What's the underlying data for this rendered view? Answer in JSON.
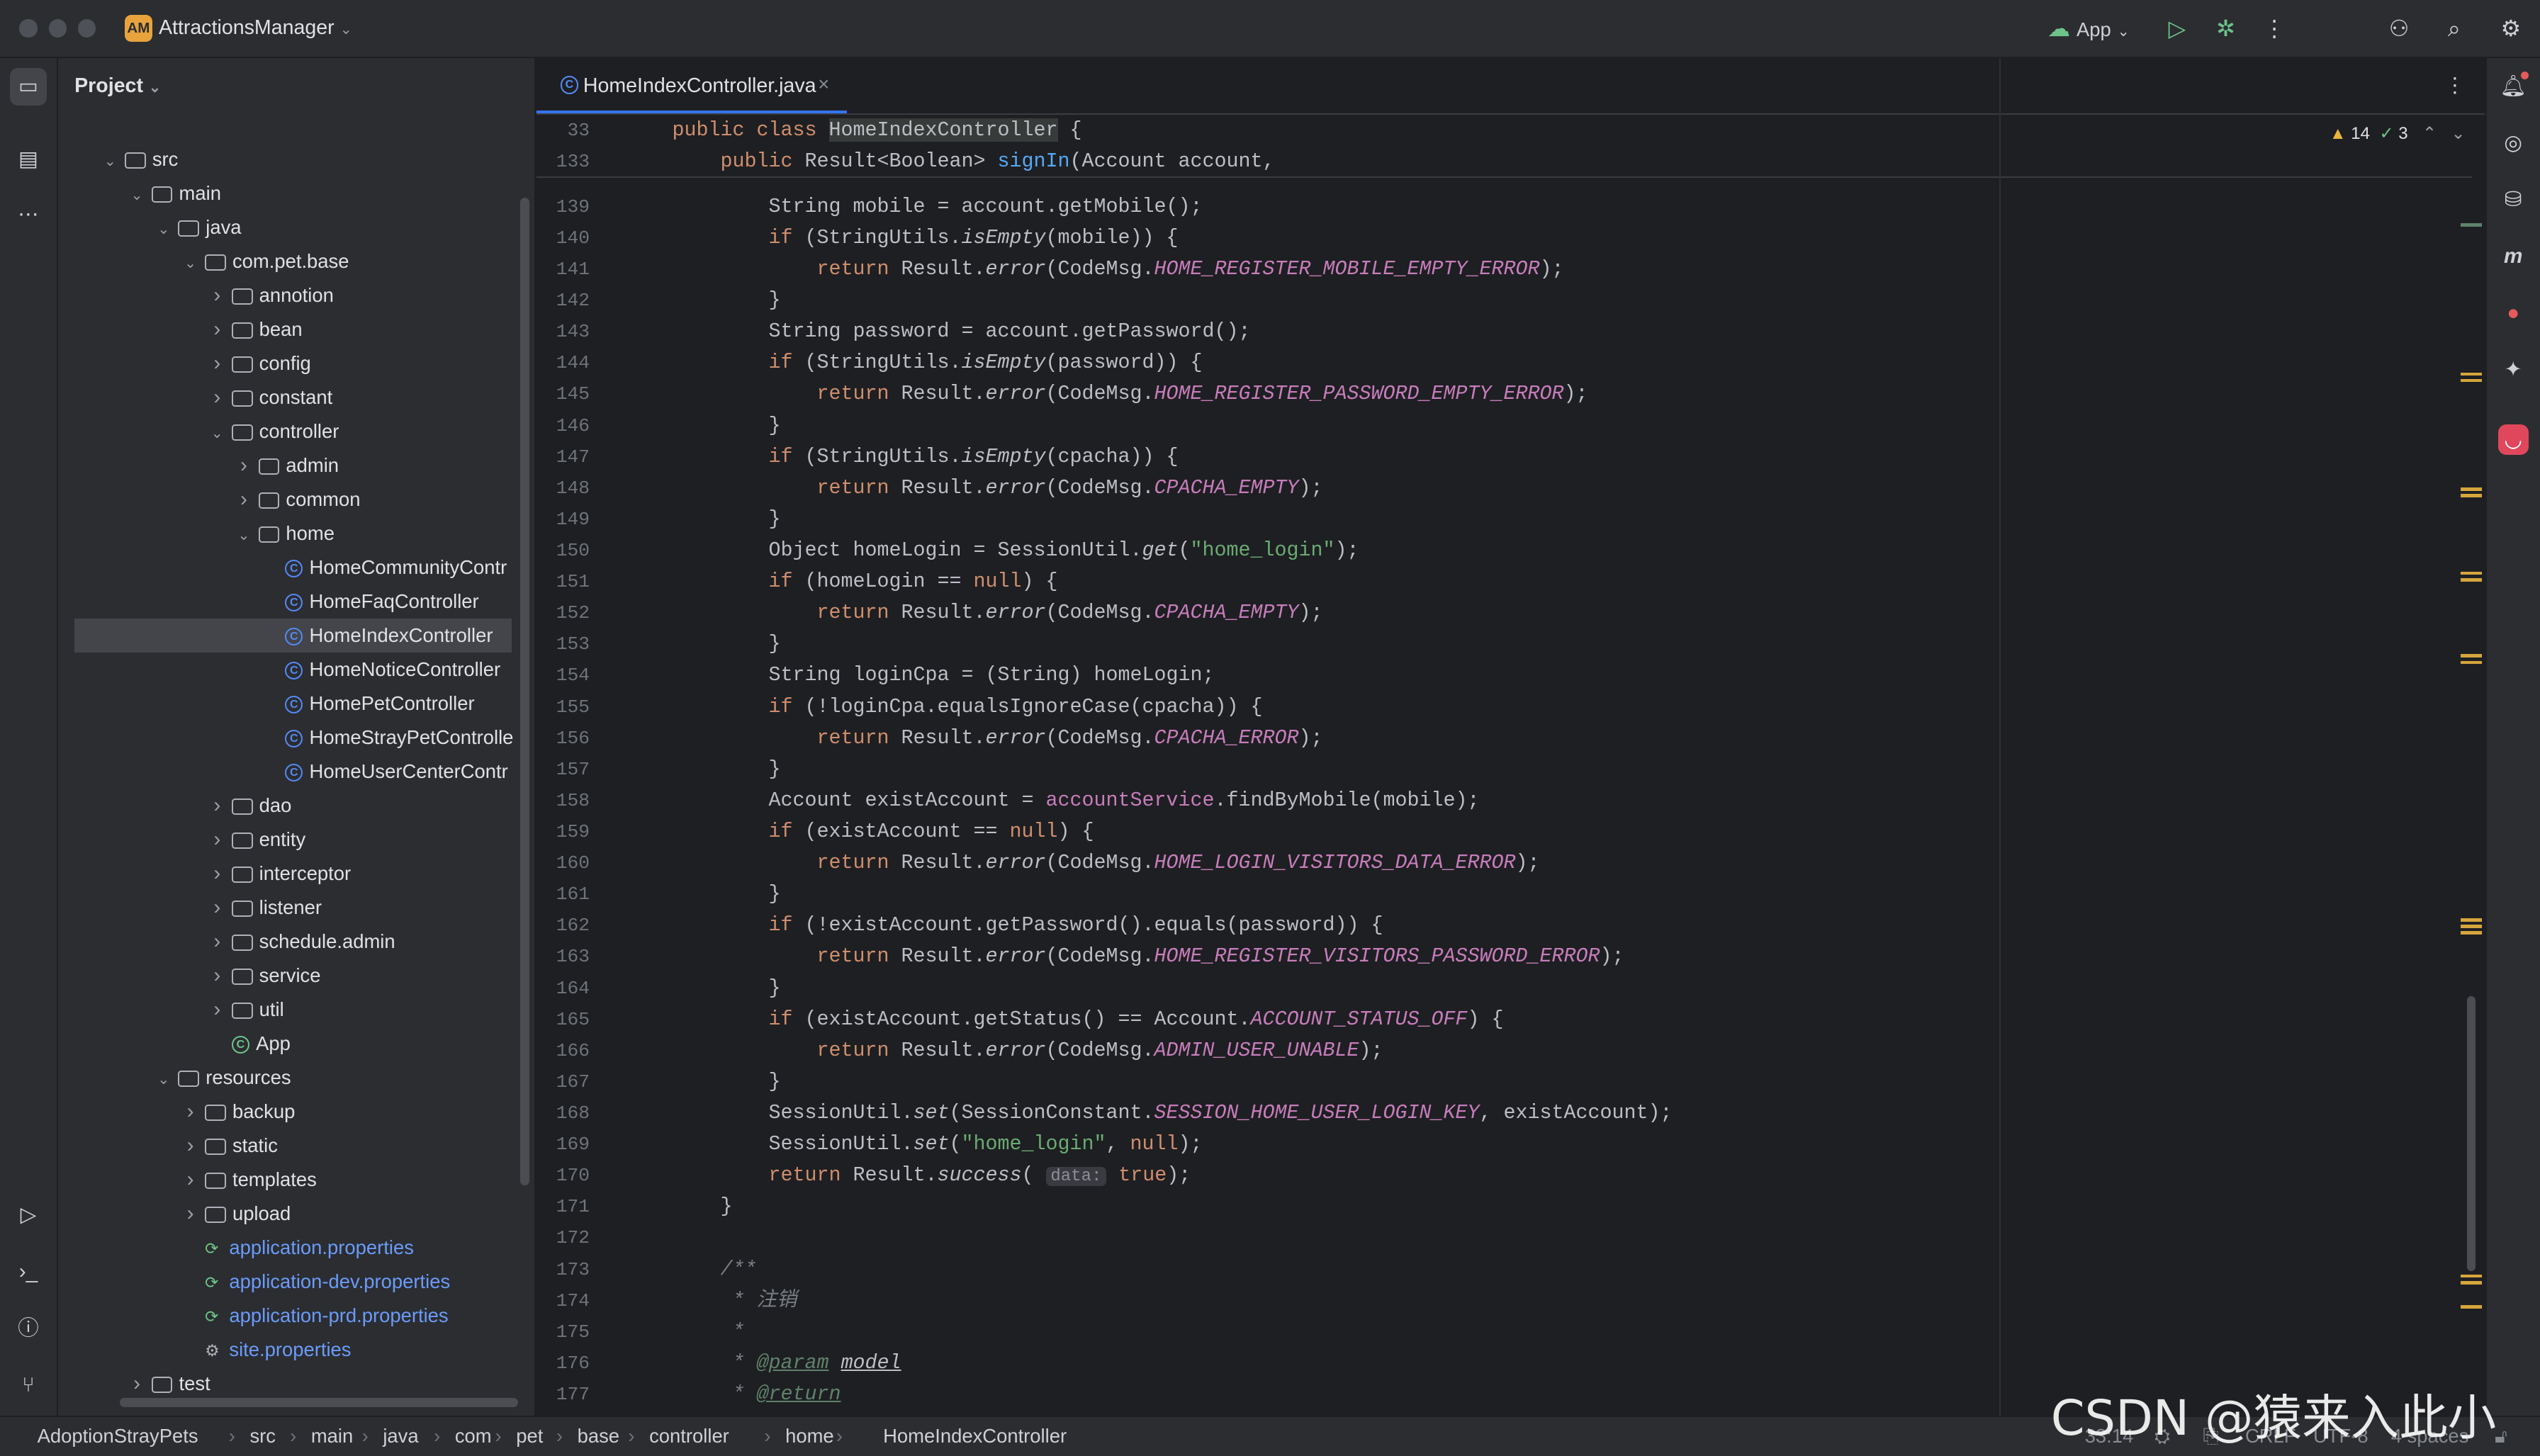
{
  "window": {
    "project_badge": "AM",
    "project_name": "AttractionsManager",
    "run_config": "App"
  },
  "project_panel": {
    "title": "Project",
    "tree": [
      {
        "label": "src",
        "depth": 1,
        "open": true,
        "kind": "folder"
      },
      {
        "label": "main",
        "depth": 2,
        "open": true,
        "kind": "folder"
      },
      {
        "label": "java",
        "depth": 3,
        "open": true,
        "kind": "folder"
      },
      {
        "label": "com.pet.base",
        "depth": 4,
        "open": true,
        "kind": "pkg"
      },
      {
        "label": "annotion",
        "depth": 5,
        "open": false,
        "kind": "pkg"
      },
      {
        "label": "bean",
        "depth": 5,
        "open": false,
        "kind": "pkg"
      },
      {
        "label": "config",
        "depth": 5,
        "open": false,
        "kind": "pkg"
      },
      {
        "label": "constant",
        "depth": 5,
        "open": false,
        "kind": "pkg"
      },
      {
        "label": "controller",
        "depth": 5,
        "open": true,
        "kind": "pkg"
      },
      {
        "label": "admin",
        "depth": 6,
        "open": false,
        "kind": "pkg"
      },
      {
        "label": "common",
        "depth": 6,
        "open": false,
        "kind": "pkg"
      },
      {
        "label": "home",
        "depth": 6,
        "open": true,
        "kind": "pkg"
      },
      {
        "label": "HomeCommunityContr",
        "depth": 7,
        "kind": "class"
      },
      {
        "label": "HomeFaqController",
        "depth": 7,
        "kind": "class"
      },
      {
        "label": "HomeIndexController",
        "depth": 7,
        "kind": "class",
        "selected": true
      },
      {
        "label": "HomeNoticeController",
        "depth": 7,
        "kind": "class"
      },
      {
        "label": "HomePetController",
        "depth": 7,
        "kind": "class"
      },
      {
        "label": "HomeStrayPetControlle",
        "depth": 7,
        "kind": "class"
      },
      {
        "label": "HomeUserCenterContr",
        "depth": 7,
        "kind": "class"
      },
      {
        "label": "dao",
        "depth": 5,
        "open": false,
        "kind": "pkg"
      },
      {
        "label": "entity",
        "depth": 5,
        "open": false,
        "kind": "pkg"
      },
      {
        "label": "interceptor",
        "depth": 5,
        "open": false,
        "kind": "pkg"
      },
      {
        "label": "listener",
        "depth": 5,
        "open": false,
        "kind": "pkg"
      },
      {
        "label": "schedule.admin",
        "depth": 5,
        "open": false,
        "kind": "pkg"
      },
      {
        "label": "service",
        "depth": 5,
        "open": false,
        "kind": "pkg"
      },
      {
        "label": "util",
        "depth": 5,
        "open": false,
        "kind": "pkg"
      },
      {
        "label": "App",
        "depth": 5,
        "kind": "app"
      },
      {
        "label": "resources",
        "depth": 3,
        "open": true,
        "kind": "folder"
      },
      {
        "label": "backup",
        "depth": 4,
        "open": false,
        "kind": "folder"
      },
      {
        "label": "static",
        "depth": 4,
        "open": false,
        "kind": "folder"
      },
      {
        "label": "templates",
        "depth": 4,
        "open": false,
        "kind": "folder"
      },
      {
        "label": "upload",
        "depth": 4,
        "open": false,
        "kind": "folder"
      },
      {
        "label": "application.properties",
        "depth": 4,
        "kind": "prop"
      },
      {
        "label": "application-dev.properties",
        "depth": 4,
        "kind": "prop"
      },
      {
        "label": "application-prd.properties",
        "depth": 4,
        "kind": "prop"
      },
      {
        "label": "site.properties",
        "depth": 4,
        "kind": "settings"
      },
      {
        "label": "test",
        "depth": 2,
        "open": false,
        "kind": "folder"
      }
    ]
  },
  "editor": {
    "tab_label": "HomeIndexController.java",
    "inspections": {
      "warnings": "14",
      "ok": "3"
    },
    "sticky": [
      {
        "n": "33",
        "html": "<span class=\"kw\">public class</span> <span class=\"hl\">HomeIndexController</span> {"
      },
      {
        "n": "133",
        "html": "    <span class=\"kw\">public</span> Result&lt;Boolean&gt; <span class=\"fn\">signIn</span>(Account account,"
      }
    ],
    "lines": [
      {
        "n": "139",
        "html": "        String mobile = account.getMobile();"
      },
      {
        "n": "140",
        "html": "        <span class=\"kw\">if</span> (StringUtils.<span class=\"it\">isEmpty</span>(mobile)) {"
      },
      {
        "n": "141",
        "html": "            <span class=\"kw\">return</span> Result.<span class=\"it\">error</span>(CodeMsg.<span class=\"cst\">HOME_REGISTER_MOBILE_EMPTY_ERROR</span>);"
      },
      {
        "n": "142",
        "html": "        }"
      },
      {
        "n": "143",
        "html": "        String password = account.getPassword();"
      },
      {
        "n": "144",
        "html": "        <span class=\"kw\">if</span> (StringUtils.<span class=\"it\">isEmpty</span>(password)) {"
      },
      {
        "n": "145",
        "html": "            <span class=\"kw\">return</span> Result.<span class=\"it\">error</span>(CodeMsg.<span class=\"cst\">HOME_REGISTER_PASSWORD_EMPTY_ERROR</span>);"
      },
      {
        "n": "146",
        "html": "        }"
      },
      {
        "n": "147",
        "html": "        <span class=\"kw\">if</span> (StringUtils.<span class=\"it\">isEmpty</span>(cpacha)) {"
      },
      {
        "n": "148",
        "html": "            <span class=\"kw\">return</span> Result.<span class=\"it\">error</span>(CodeMsg.<span class=\"cst\">CPACHA_EMPTY</span>);"
      },
      {
        "n": "149",
        "html": "        }"
      },
      {
        "n": "150",
        "html": "        Object homeLogin = SessionUtil.<span class=\"it\">get</span>(<span class=\"str\">\"home_login\"</span>);"
      },
      {
        "n": "151",
        "html": "        <span class=\"kw\">if</span> (homeLogin == <span class=\"kw\">null</span>) {"
      },
      {
        "n": "152",
        "html": "            <span class=\"kw\">return</span> Result.<span class=\"it\">error</span>(CodeMsg.<span class=\"cst\">CPACHA_EMPTY</span>);"
      },
      {
        "n": "153",
        "html": "        }"
      },
      {
        "n": "154",
        "html": "        String loginCpa = (String) homeLogin;"
      },
      {
        "n": "155",
        "html": "        <span class=\"kw\">if</span> (!loginCpa.equalsIgnoreCase(cpacha)) {"
      },
      {
        "n": "156",
        "html": "            <span class=\"kw\">return</span> Result.<span class=\"it\">error</span>(CodeMsg.<span class=\"cst\">CPACHA_ERROR</span>);"
      },
      {
        "n": "157",
        "html": "        }"
      },
      {
        "n": "158",
        "html": "        Account existAccount = <span class=\"fld\">accountService</span>.findByMobile(mobile);"
      },
      {
        "n": "159",
        "html": "        <span class=\"kw\">if</span> (existAccount == <span class=\"kw\">null</span>) {"
      },
      {
        "n": "160",
        "html": "            <span class=\"kw\">return</span> Result.<span class=\"it\">error</span>(CodeMsg.<span class=\"cst\">HOME_LOGIN_VISITORS_DATA_ERROR</span>);"
      },
      {
        "n": "161",
        "html": "        }"
      },
      {
        "n": "162",
        "html": "        <span class=\"kw\">if</span> (!existAccount.getPassword().equals(password)) {"
      },
      {
        "n": "163",
        "html": "            <span class=\"kw\">return</span> Result.<span class=\"it\">error</span>(CodeMsg.<span class=\"cst\">HOME_REGISTER_VISITORS_PASSWORD_ERROR</span>);"
      },
      {
        "n": "164",
        "html": "        }"
      },
      {
        "n": "165",
        "html": "        <span class=\"kw\">if</span> (existAccount.getStatus() == Account.<span class=\"cst\">ACCOUNT_STATUS_OFF</span>) {"
      },
      {
        "n": "166",
        "html": "            <span class=\"kw\">return</span> Result.<span class=\"it\">error</span>(CodeMsg.<span class=\"cst\">ADMIN_USER_UNABLE</span>);"
      },
      {
        "n": "167",
        "html": "        }"
      },
      {
        "n": "168",
        "html": "        SessionUtil.<span class=\"it\">set</span>(SessionConstant.<span class=\"cst\">SESSION_HOME_USER_LOGIN_KEY</span>, existAccount);"
      },
      {
        "n": "169",
        "html": "        SessionUtil.<span class=\"it\">set</span>(<span class=\"str\">\"home_login\"</span>, <span class=\"kw\">null</span>);"
      },
      {
        "n": "170",
        "html": "        <span class=\"kw\">return</span> Result.<span class=\"it\">success</span>( <span class=\"hint\">data:</span> <span class=\"kw\">true</span>);"
      },
      {
        "n": "171",
        "html": "    }"
      },
      {
        "n": "172",
        "html": ""
      },
      {
        "n": "173",
        "html": "    <span class=\"cmt\">/**</span>"
      },
      {
        "n": "174",
        "html": "<span class=\"cmt\">     * 注销</span>"
      },
      {
        "n": "175",
        "html": "<span class=\"cmt\">     *</span>"
      },
      {
        "n": "176",
        "html": "<span class=\"cmt\">     * </span><span class=\"doctag\">@param</span><span class=\"cmt\"> </span><span class=\"doctag\" style=\"color:#bcbec4\">model</span>"
      },
      {
        "n": "177",
        "html": "<span class=\"cmt\">     * </span><span class=\"doctag\">@return</span>"
      }
    ]
  },
  "statusbar": {
    "breadcrumbs": [
      "AdoptionStrayPets",
      "src",
      "main",
      "java",
      "com",
      "pet",
      "base",
      "controller",
      "home",
      "HomeIndexController"
    ],
    "position": "33:14",
    "line_sep": "CRLF",
    "encoding": "UTF-8",
    "indent": "4 spaces"
  },
  "watermark": "CSDN @猿来入此小猿"
}
